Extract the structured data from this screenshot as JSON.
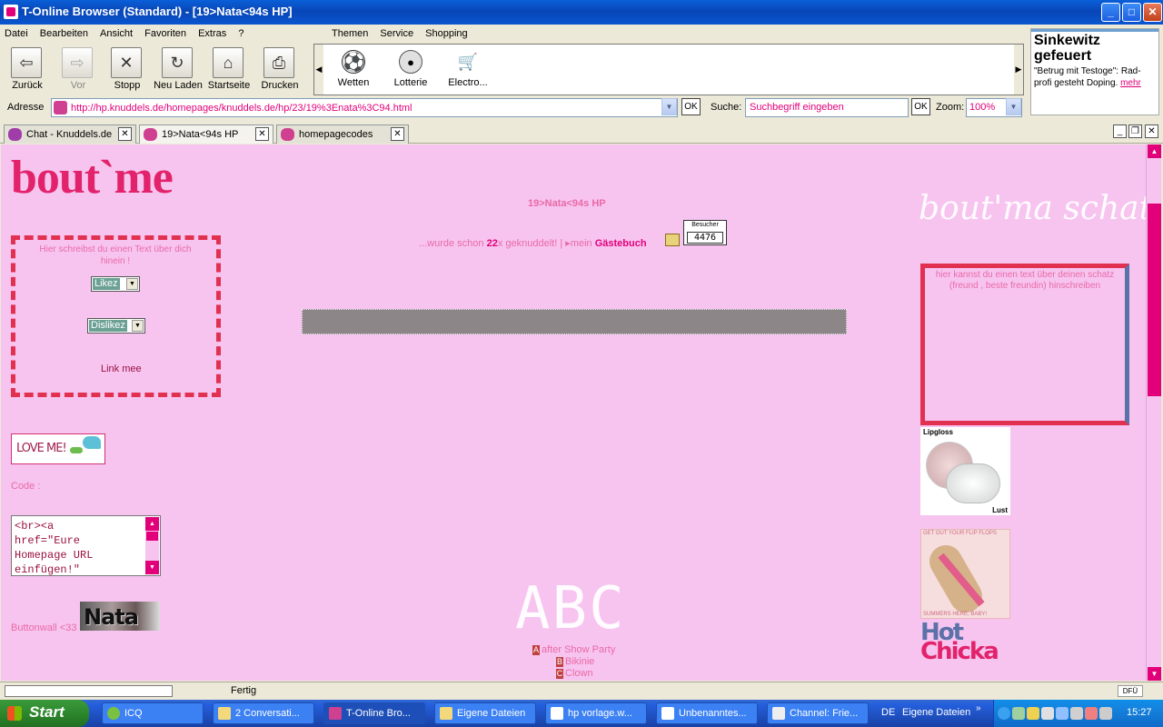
{
  "window": {
    "title": "T-Online Browser (Standard) - [19>Nata<94s HP]",
    "minimize": "_",
    "maximize": "□",
    "close": "✕"
  },
  "menu": {
    "items": [
      "Datei",
      "Bearbeiten",
      "Ansicht",
      "Favoriten",
      "Extras",
      "?"
    ],
    "themen": [
      "Themen",
      "Service",
      "Shopping"
    ]
  },
  "toolbar": {
    "back": {
      "label": "Zurück",
      "icon": "back-arrow-icon"
    },
    "forward": {
      "label": "Vor",
      "icon": "forward-arrow-icon"
    },
    "stop": {
      "label": "Stopp",
      "icon": "stop-x-icon"
    },
    "reload": {
      "label": "Neu Laden",
      "icon": "reload-icon"
    },
    "home": {
      "label": "Startseite",
      "icon": "home-icon"
    },
    "print": {
      "label": "Drucken",
      "icon": "printer-icon"
    }
  },
  "channels": [
    {
      "label": "Wetten",
      "icon": "soccer-ball-icon"
    },
    {
      "label": "Lotterie",
      "icon": "lottery-ball-icon"
    },
    {
      "label": "Electro...",
      "icon": "shopping-cart-icon"
    }
  ],
  "news": {
    "headline": "Sinkewitz gefeuert",
    "text": "\"Betrug mit Testoge\": Rad-profi gesteht Doping.",
    "link": "mehr"
  },
  "address_bar": {
    "label": "Adresse",
    "url": "http://hp.knuddels.de/homepages/knuddels.de/hp/23/19%3Enata%3C94.html",
    "ok": "OK",
    "search_label": "Suche:",
    "search_placeholder": "Suchbegriff eingeben",
    "zoom_label": "Zoom:",
    "zoom_value": "100%"
  },
  "tabs": [
    {
      "label": "Chat - Knuddels.de"
    },
    {
      "label": "19>Nata<94s HP"
    },
    {
      "label": "homepagecodes"
    }
  ],
  "page": {
    "bout_me": "bout`me",
    "intro_text": "Hier schreibst du einen Text über dich hinein !",
    "likez": "Likez",
    "dislikez": "Dislikez",
    "link_mee": "Link mee",
    "love_me": "LOVE ME!",
    "code_label": "Code :",
    "code_text": "<br><a\nhref=\"Eure\nHomepage URL\neinfügen!\"",
    "buttonwall_label": "Buttonwall <33",
    "nata_button": "Nata",
    "hp_title": "19>Nata<94s HP",
    "counter_prefix": "...wurde schon",
    "counter_value": "22",
    "counter_suffix": "x geknuddelt! |",
    "guestbook_prefix": "mein",
    "guestbook": "Gästebuch",
    "visitor_label": "Besucher",
    "visitor_count": "4476",
    "abc": "ABC",
    "letters": [
      {
        "cap": "A",
        "text": "after Show Party"
      },
      {
        "cap": "B",
        "text": "Bikinie"
      },
      {
        "cap": "C",
        "text": "Clown"
      }
    ],
    "right_script": "bout'ma schatzii",
    "right_text": "hier kannst du einen text über deinen schatz (freund , beste freundin) hinschreiben",
    "lipgloss_top": "Lipgloss",
    "lipgloss_bottom": "Lust",
    "flipflop_top": "GET OUT YOUR FLIP FLOPS",
    "flipflop_bottom": "SUMMERS HERE, BABY!",
    "hot": "Hot",
    "chicka": "Chicka"
  },
  "status": {
    "text": "Fertig",
    "dfu": "DFÜ"
  },
  "taskbar": {
    "start": "Start",
    "tasks": [
      "ICQ",
      "2 Conversati...",
      "T-Online Bro...",
      "Eigene Dateien",
      "hp vorlage.w...",
      "Unbenanntes...",
      "Channel: Frie..."
    ],
    "lang": "DE",
    "eigene_dateien": "Eigene Dateien",
    "expand": "»",
    "clock": "15:27"
  },
  "colors": {
    "page_bg": "#f7c4f0",
    "accent": "#e2007a",
    "title_blue": "#0a55cf"
  }
}
